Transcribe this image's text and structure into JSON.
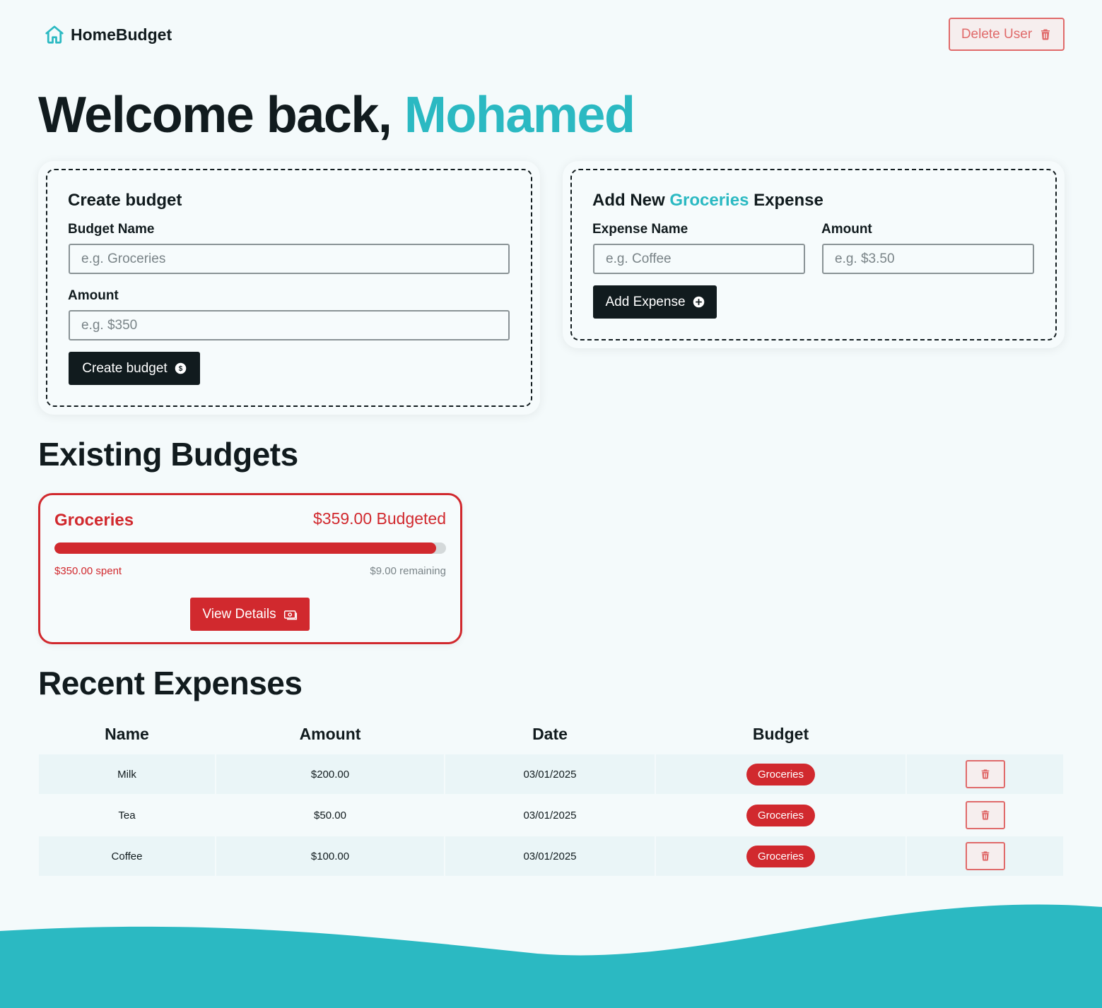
{
  "app": {
    "name": "HomeBudget",
    "delete_user_label": "Delete User"
  },
  "welcome": {
    "prefix": "Welcome back,",
    "user_name": "Mohamed"
  },
  "create_budget": {
    "title": "Create budget",
    "name_label": "Budget Name",
    "name_placeholder": "e.g. Groceries",
    "amount_label": "Amount",
    "amount_placeholder": "e.g. $350",
    "button_label": "Create budget"
  },
  "add_expense": {
    "title_prefix": "Add New",
    "title_budget": "Groceries",
    "title_suffix": "Expense",
    "name_label": "Expense Name",
    "name_placeholder": "e.g. Coffee",
    "amount_label": "Amount",
    "amount_placeholder": "e.g. $3.50",
    "button_label": "Add Expense"
  },
  "existing_budgets": {
    "title": "Existing Budgets",
    "budgets": [
      {
        "name": "Groceries",
        "budgeted": "$359.00 Budgeted",
        "spent": "$350.00 spent",
        "remaining": "$9.00 remaining",
        "progress_fraction": 0.975,
        "view_label": "View Details"
      }
    ]
  },
  "recent_expenses": {
    "title": "Recent Expenses",
    "columns": [
      "Name",
      "Amount",
      "Date",
      "Budget"
    ],
    "rows": [
      {
        "name": "Milk",
        "amount": "$200.00",
        "date": "03/01/2025",
        "budget": "Groceries"
      },
      {
        "name": "Tea",
        "amount": "$50.00",
        "date": "03/01/2025",
        "budget": "Groceries"
      },
      {
        "name": "Coffee",
        "amount": "$100.00",
        "date": "03/01/2025",
        "budget": "Groceries"
      }
    ]
  },
  "colors": {
    "accent": "#2bb9c2",
    "danger": "#d1292e",
    "dark": "#111b1e",
    "background": "#f4fafb"
  },
  "icons": {
    "logo": "house-icon",
    "delete_user": "trash-icon",
    "create_budget": "dollar-circle-icon",
    "add_expense": "plus-circle-icon",
    "view_details": "banknote-icon",
    "row_delete": "trash-icon"
  }
}
